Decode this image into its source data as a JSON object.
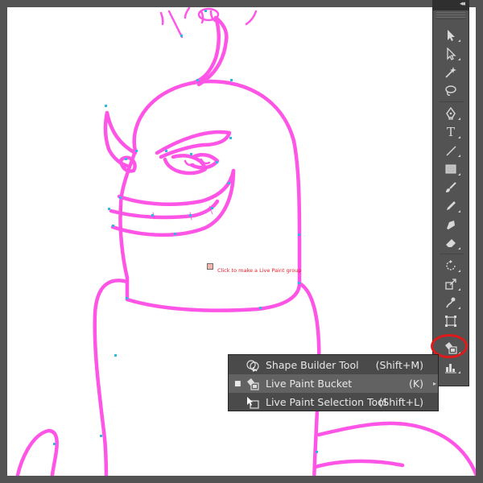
{
  "canvas": {
    "hint_text": "Click to make a Live Paint group"
  },
  "tools_panel": {
    "collapse_glyph": "◂◂",
    "tools": [
      {
        "name": "selection-tool-icon"
      },
      {
        "name": "direct-selection-tool-icon"
      },
      {
        "name": "magic-wand-tool-icon"
      },
      {
        "name": "lasso-tool-icon"
      },
      {
        "name": "pen-tool-icon"
      },
      {
        "name": "type-tool-icon",
        "glyph": "T"
      },
      {
        "name": "line-segment-tool-icon"
      },
      {
        "name": "rectangle-tool-icon"
      },
      {
        "name": "paintbrush-tool-icon"
      },
      {
        "name": "pencil-tool-icon"
      },
      {
        "name": "blob-brush-tool-icon"
      },
      {
        "name": "eraser-tool-icon"
      },
      {
        "name": "rotate-tool-icon"
      },
      {
        "name": "scale-tool-icon"
      },
      {
        "name": "warp-tool-icon"
      },
      {
        "name": "free-transform-tool-icon"
      },
      {
        "name": "live-paint-bucket-tool-icon",
        "active": true
      },
      {
        "name": "graph-tool-icon"
      }
    ]
  },
  "flyout_menu": {
    "items": [
      {
        "label": "Shape Builder Tool",
        "shortcut": "(Shift+M)",
        "icon": "shape-builder-icon",
        "selected": false,
        "check": ""
      },
      {
        "label": "Live Paint Bucket",
        "shortcut": "(K)",
        "icon": "live-paint-bucket-icon",
        "selected": true,
        "check": "■"
      },
      {
        "label": "Live Paint Selection Tool",
        "shortcut": "(Shift+L)",
        "icon": "live-paint-selection-icon",
        "selected": false,
        "check": ""
      }
    ],
    "tearoff_glyph": "▸"
  },
  "colors": {
    "workspace": "#535353",
    "artboard": "#ffffff",
    "path_stroke": "#ff55e6",
    "anchor_point": "#2fb9e0",
    "hint_text": "#e8202a",
    "highlight_ring": "#e01a1a",
    "menu_background": "#4a4a4a",
    "menu_selected": "#626262"
  }
}
